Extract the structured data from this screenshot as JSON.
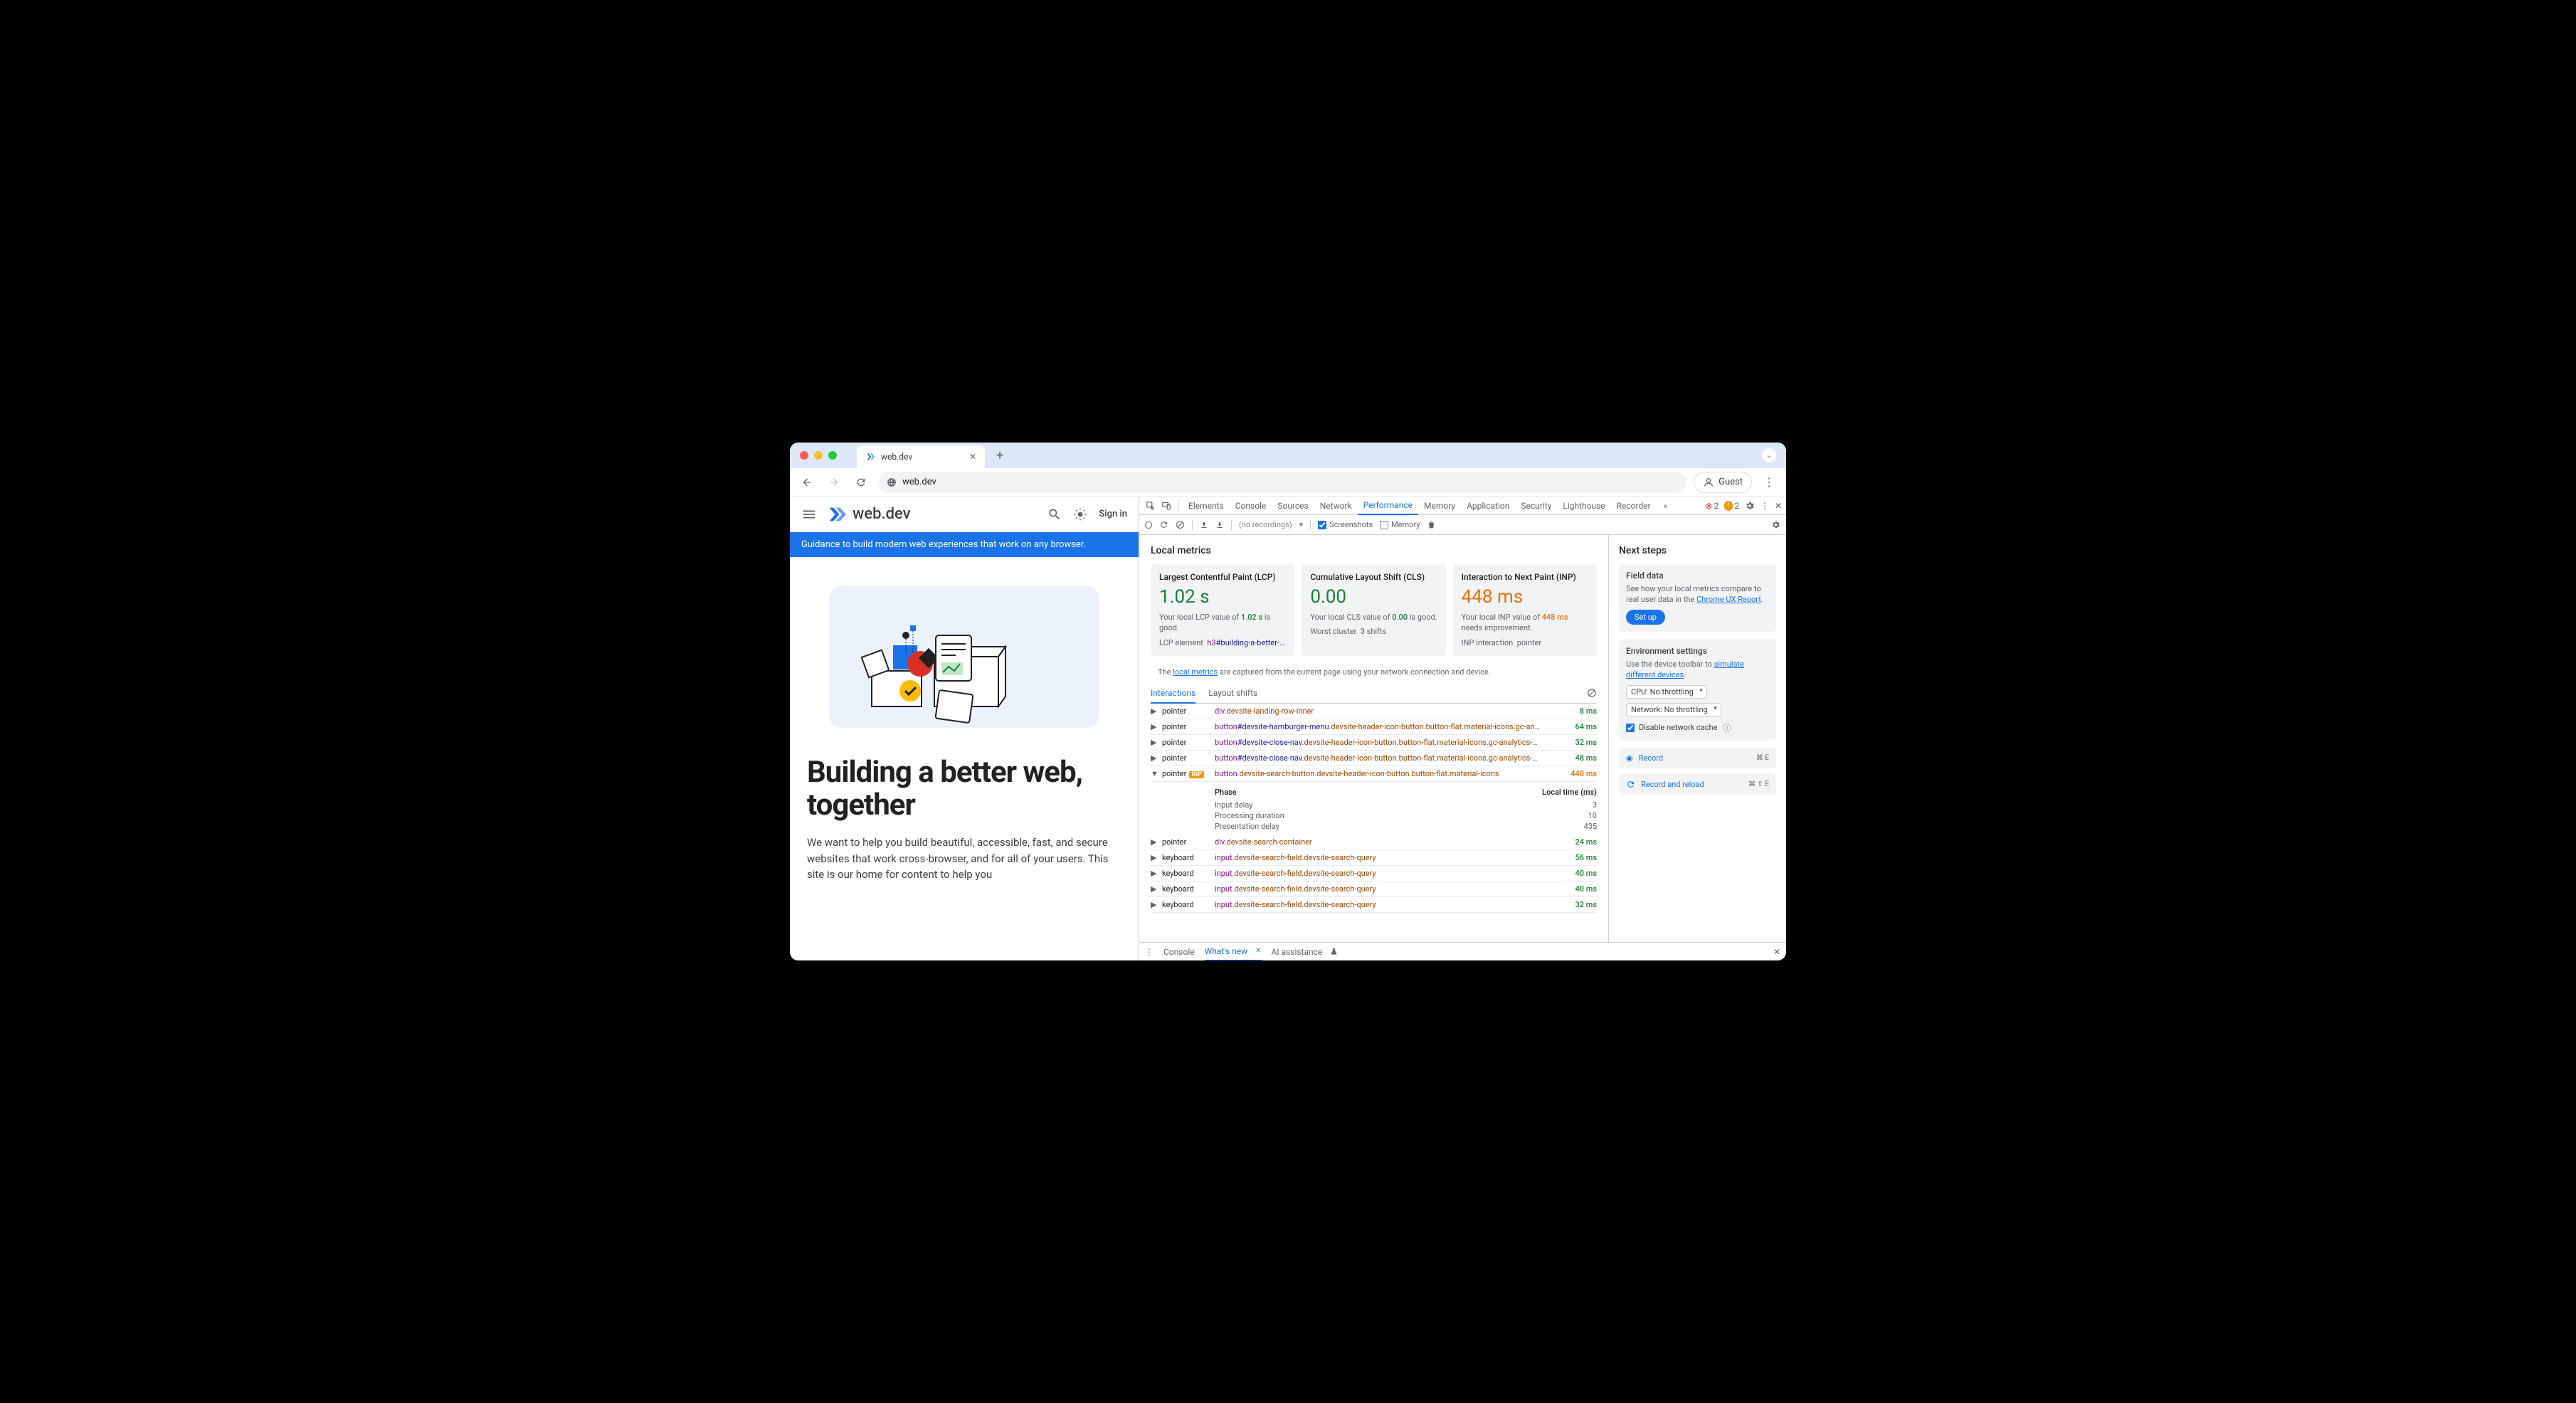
{
  "browser": {
    "tab_title": "web.dev",
    "url": "web.dev",
    "guest_label": "Guest"
  },
  "page": {
    "logo_text": "web.dev",
    "signin": "Sign in",
    "banner": "Guidance to build modern web experiences that work on any browser.",
    "hero_title": "Building a better web, together",
    "hero_body": "We want to help you build beautiful, accessible, fast, and secure websites that work cross-browser, and for all of your users. This site is our home for content to help you"
  },
  "devtools": {
    "tabs": [
      "Elements",
      "Console",
      "Sources",
      "Network",
      "Performance",
      "Memory",
      "Application",
      "Security",
      "Lighthouse",
      "Recorder"
    ],
    "active_tab": "Performance",
    "err_count": "2",
    "warn_count": "2",
    "ctrl": {
      "norec": "(no recordings)",
      "screenshots": "Screenshots",
      "memory": "Memory"
    },
    "local_metrics_title": "Local metrics",
    "metrics": {
      "lcp": {
        "title": "Largest Contentful Paint (LCP)",
        "value": "1.02 s",
        "desc_pre": "Your local LCP value of ",
        "desc_val": "1.02 s",
        "desc_post": " is good.",
        "sub_label": "LCP element",
        "sub_tag": "h3",
        "sub_id": "#building-a-better-…"
      },
      "cls": {
        "title": "Cumulative Layout Shift (CLS)",
        "value": "0.00",
        "desc_pre": "Your local CLS value of ",
        "desc_val": "0.00",
        "desc_post": " is good.",
        "sub_label": "Worst cluster",
        "sub_link": "3 shifts"
      },
      "inp": {
        "title": "Interaction to Next Paint (INP)",
        "value": "448 ms",
        "desc_pre": "Your local INP value of ",
        "desc_val": "448 ms",
        "desc_post": " needs improvement.",
        "sub_label": "INP interaction",
        "sub_link": "pointer"
      }
    },
    "info_pre": "The ",
    "info_link": "local metrics",
    "info_post": " are captured from the current page using your network connection and device.",
    "subtabs": {
      "a": "Interactions",
      "b": "Layout shifts"
    },
    "phase_header": {
      "name": "Phase",
      "val": "Local time (ms)"
    },
    "phases": [
      {
        "name": "Input delay",
        "val": "3"
      },
      {
        "name": "Processing duration",
        "val": "10"
      },
      {
        "name": "Presentation delay",
        "val": "435"
      }
    ],
    "interactions": [
      {
        "type": "pointer",
        "tag": "div",
        "cls": ".devsite-landing-row-inner",
        "ms": "8 ms",
        "open": false
      },
      {
        "type": "pointer",
        "tag": "button",
        "id": "#devsite-hamburger-menu",
        "cls": ".devsite-header-icon-button.button-flat.material-icons.gc-an…",
        "ms": "64 ms",
        "open": false
      },
      {
        "type": "pointer",
        "tag": "button",
        "id": "#devsite-close-nav",
        "cls": ".devsite-header-icon-button.button-flat.material-icons.gc-analytics-…",
        "ms": "32 ms",
        "open": false
      },
      {
        "type": "pointer",
        "tag": "button",
        "id": "#devsite-close-nav",
        "cls": ".devsite-header-icon-button.button-flat.material-icons.gc-analytics-…",
        "ms": "48 ms",
        "open": false
      },
      {
        "type": "pointer",
        "badge": "INP",
        "tag": "button",
        "cls": ".devsite-search-button.devsite-header-icon-button.button-flat.material-icons",
        "ms": "448 ms",
        "open": true,
        "bad": true
      },
      {
        "type": "pointer",
        "tag": "div",
        "cls": ".devsite-search-container",
        "ms": "24 ms",
        "open": false
      },
      {
        "type": "keyboard",
        "tag": "input",
        "cls": ".devsite-search-field.devsite-search-query",
        "ms": "56 ms",
        "open": false
      },
      {
        "type": "keyboard",
        "tag": "input",
        "cls": ".devsite-search-field.devsite-search-query",
        "ms": "40 ms",
        "open": false
      },
      {
        "type": "keyboard",
        "tag": "input",
        "cls": ".devsite-search-field.devsite-search-query",
        "ms": "40 ms",
        "open": false
      },
      {
        "type": "keyboard",
        "tag": "input",
        "cls": ".devsite-search-field.devsite-search-query",
        "ms": "32 ms",
        "open": false
      }
    ],
    "sidebar": {
      "title": "Next steps",
      "field": {
        "title": "Field data",
        "body_pre": "See how your local metrics compare to real user data in the ",
        "body_link": "Chrome UX Report",
        "body_post": ".",
        "btn": "Set up"
      },
      "env": {
        "title": "Environment settings",
        "body_pre": "Use the device toolbar to ",
        "body_link": "simulate different devices",
        "body_post": ".",
        "cpu": "CPU: No throttling",
        "net": "Network: No throttling",
        "cache": "Disable network cache"
      },
      "record": {
        "label": "Record",
        "kbd": "⌘ E"
      },
      "reload": {
        "label": "Record and reload",
        "kbd": "⌘ ⇧ E"
      }
    },
    "drawer": {
      "console": "Console",
      "whatsnew": "What's new",
      "ai": "AI assistance"
    }
  }
}
